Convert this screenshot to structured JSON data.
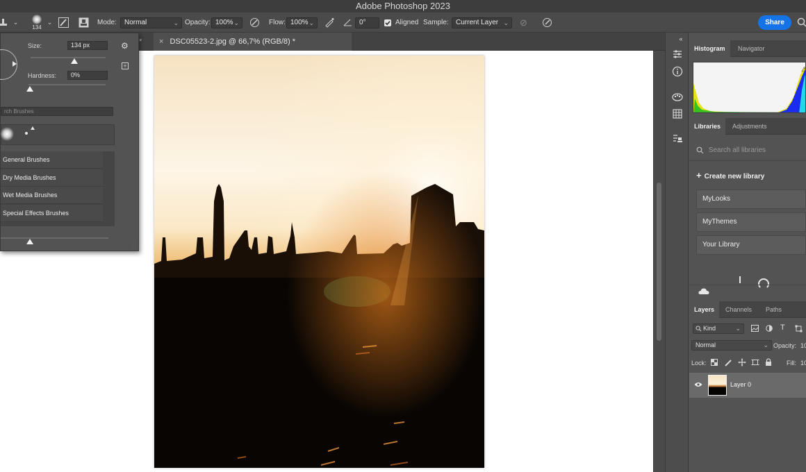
{
  "app": {
    "title": "Adobe Photoshop 2023"
  },
  "options_bar": {
    "brush_size": "134",
    "mode_label": "Mode:",
    "mode_value": "Normal",
    "opacity_label": "Opacity:",
    "opacity_value": "100%",
    "flow_label": "Flow:",
    "flow_value": "100%",
    "angle_value": "0°",
    "aligned_label": "Aligned",
    "sample_label": "Sample:",
    "sample_value": "Current Layer",
    "share_label": "Share"
  },
  "document_tabs": [
    {
      "label": "DSC05523-2.jpg @ 66,7% (RGB/8) *",
      "close": "×"
    }
  ],
  "brush_popup": {
    "size_label": "Size:",
    "size_value": "134 px",
    "hardness_label": "Hardness:",
    "hardness_value": "0%",
    "search_placeholder": "rch Brushes",
    "folders": [
      "General Brushes",
      "Dry Media Brushes",
      "Wet Media Brushes",
      "Special Effects Brushes"
    ]
  },
  "histogram_panel": {
    "tabs": [
      "Histogram",
      "Navigator"
    ],
    "colors": {
      "yellow": "#e8e000",
      "green": "#22c020",
      "blue": "#1a2cf0",
      "cyan": "#20d8e8"
    }
  },
  "libraries_panel": {
    "tabs": [
      "Libraries",
      "Adjustments"
    ],
    "search_placeholder": "Search all libraries",
    "create_label": "Create new library",
    "libraries": [
      "MyLooks",
      "MyThemes",
      "Your Library"
    ]
  },
  "layers_panel": {
    "tabs": [
      "Layers",
      "Channels",
      "Paths"
    ],
    "filter_value": "Kind",
    "blend_mode": "Normal",
    "opacity_label": "Opacity:",
    "opacity_value": "10",
    "lock_label": "Lock:",
    "fill_label": "Fill:",
    "fill_value": "10",
    "layers": [
      {
        "name": "Layer 0",
        "visible": true
      }
    ]
  },
  "colors": {
    "accent": "#1473e6",
    "panel": "#535353",
    "canvas": "#ffffff"
  }
}
